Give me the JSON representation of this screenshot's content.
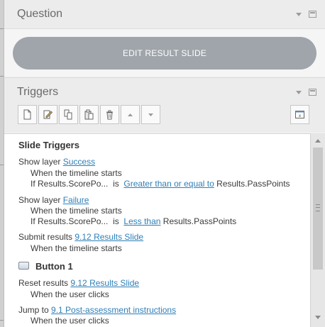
{
  "question_panel": {
    "title": "Question",
    "edit_button_label": "EDIT RESULT SLIDE"
  },
  "triggers_panel": {
    "title": "Triggers",
    "toolbar_icons": [
      "new-trigger-icon",
      "edit-trigger-icon",
      "copy-icon",
      "paste-icon",
      "delete-icon",
      "move-up-icon",
      "move-down-icon",
      "variables-icon"
    ]
  },
  "trigger_list": {
    "slide_heading": "Slide Triggers",
    "t1": {
      "action": "Show layer",
      "target": "Success",
      "when": "When the timeline starts",
      "cond_prefix": "If Results.ScorePo...",
      "cond_is": "is",
      "cond_op": "Greater than or equal to",
      "cond_value": "Results.PassPoints"
    },
    "t2": {
      "action": "Show layer",
      "target": "Failure",
      "when": "When the timeline starts",
      "cond_prefix": "If Results.ScorePo...",
      "cond_is": "is",
      "cond_op": "Less than",
      "cond_value": "Results.PassPoints"
    },
    "t3": {
      "action": "Submit results",
      "target": "9.12 Results Slide",
      "when": "When the timeline starts"
    },
    "object_name": "Button 1",
    "t4": {
      "action": "Reset results",
      "target": "9.12 Results Slide",
      "when": "When the user clicks"
    },
    "t5": {
      "action": "Jump to",
      "target": "9.1 Post-assessment instructions",
      "when": "When the user clicks"
    }
  },
  "colors": {
    "link": "#2f7fb7",
    "button": "#9fa5ab",
    "panel": "#ececec"
  }
}
